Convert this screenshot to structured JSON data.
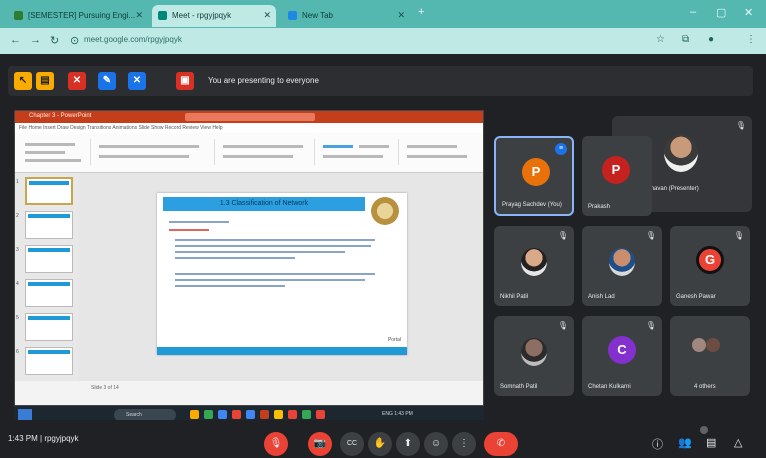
{
  "browser": {
    "tabs": [
      {
        "label": "[SEMESTER] Pursuing Engi...",
        "active": false
      },
      {
        "label": "Meet - rpgyjpqyk",
        "active": true
      },
      {
        "label": "New Tab",
        "active": false
      }
    ],
    "new_tab": "+",
    "window_controls": {
      "minimize": "–",
      "maximize": "▢",
      "close": "✕"
    },
    "url": "meet.google.com/rpgyjpqyk"
  },
  "presentation_bar": {
    "label": "You are presenting to everyone",
    "tool_icons": [
      "pointer",
      "highlighter",
      "eraser",
      "pen",
      "share"
    ],
    "stop_icon": "stop-present-icon"
  },
  "shared_screen": {
    "app_title": "Chapter 3 - PowerPoint",
    "menu": "File  Home  Insert  Draw  Design  Transitions  Animations  Slide Show  Record  Review  View  Help",
    "slide_title": "1.3  Classification of Network",
    "slide_logo": "Portal",
    "status_text": "Slide 3 of 14",
    "thumb_numbers": [
      "1",
      "2",
      "3",
      "4",
      "5",
      "6"
    ],
    "taskbar_search": "Search",
    "tray_text": "ENG  1:43 PM"
  },
  "participants": [
    {
      "name": "Prayag Sachdev (You)",
      "initial": "P",
      "color": "#e8710a",
      "speaking": true
    },
    {
      "name": "Prakash",
      "initial": "P",
      "color": "#c5221f",
      "speaking": false
    },
    {
      "name": "Nikhil Patil",
      "initial": "",
      "color": "",
      "speaking": false
    },
    {
      "name": "Anish Lad",
      "initial": "",
      "color": "",
      "speaking": false
    },
    {
      "name": "Ganesh Pawar",
      "initial": "G",
      "color": "#ea4335",
      "speaking": false
    },
    {
      "name": "Somnath Patil",
      "initial": "",
      "color": "",
      "speaking": false
    },
    {
      "name": "Chetan Kulkarni",
      "initial": "C",
      "color": "#8430ce",
      "speaking": false
    },
    {
      "name": "4 others",
      "initial": "",
      "color": "",
      "speaking": false
    }
  ],
  "pinned": {
    "name": "Dr. Sunil Chavan (Presenter)"
  },
  "bottom_bar": {
    "time_and_code": "1:43 PM  |  rpgyjpqyk",
    "controls": [
      {
        "name": "mic-off",
        "glyph": "🎙"
      },
      {
        "name": "camera-off",
        "glyph": "📷"
      },
      {
        "name": "captions",
        "glyph": "CC"
      },
      {
        "name": "raise-hand",
        "glyph": "✋"
      },
      {
        "name": "present",
        "glyph": "⬆"
      },
      {
        "name": "reactions",
        "glyph": "☺"
      },
      {
        "name": "more-options",
        "glyph": "⋮"
      }
    ],
    "end_call": "✆",
    "right_icons": [
      "info-icon",
      "people-icon",
      "chat-icon",
      "activities-icon"
    ]
  }
}
